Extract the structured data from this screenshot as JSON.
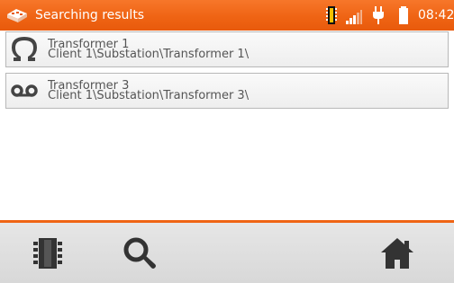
{
  "header": {
    "title": "Searching results",
    "time": "08:42",
    "accent_color": "#ef6414",
    "icons": [
      "device-logo-icon",
      "memory-card-icon",
      "signal-strength-icon",
      "power-plug-icon",
      "battery-icon"
    ]
  },
  "results": [
    {
      "name": "Transformer 1",
      "path": "Client 1\\Substation\\Transformer 1\\",
      "icon": "omega-icon"
    },
    {
      "name": "Transformer 3",
      "path": "Client 1\\Substation\\Transformer 3\\",
      "icon": "double-loop-icon"
    }
  ],
  "toolbar": {
    "icons": [
      "memory-chip-icon",
      "search-icon",
      "home-icon"
    ]
  }
}
